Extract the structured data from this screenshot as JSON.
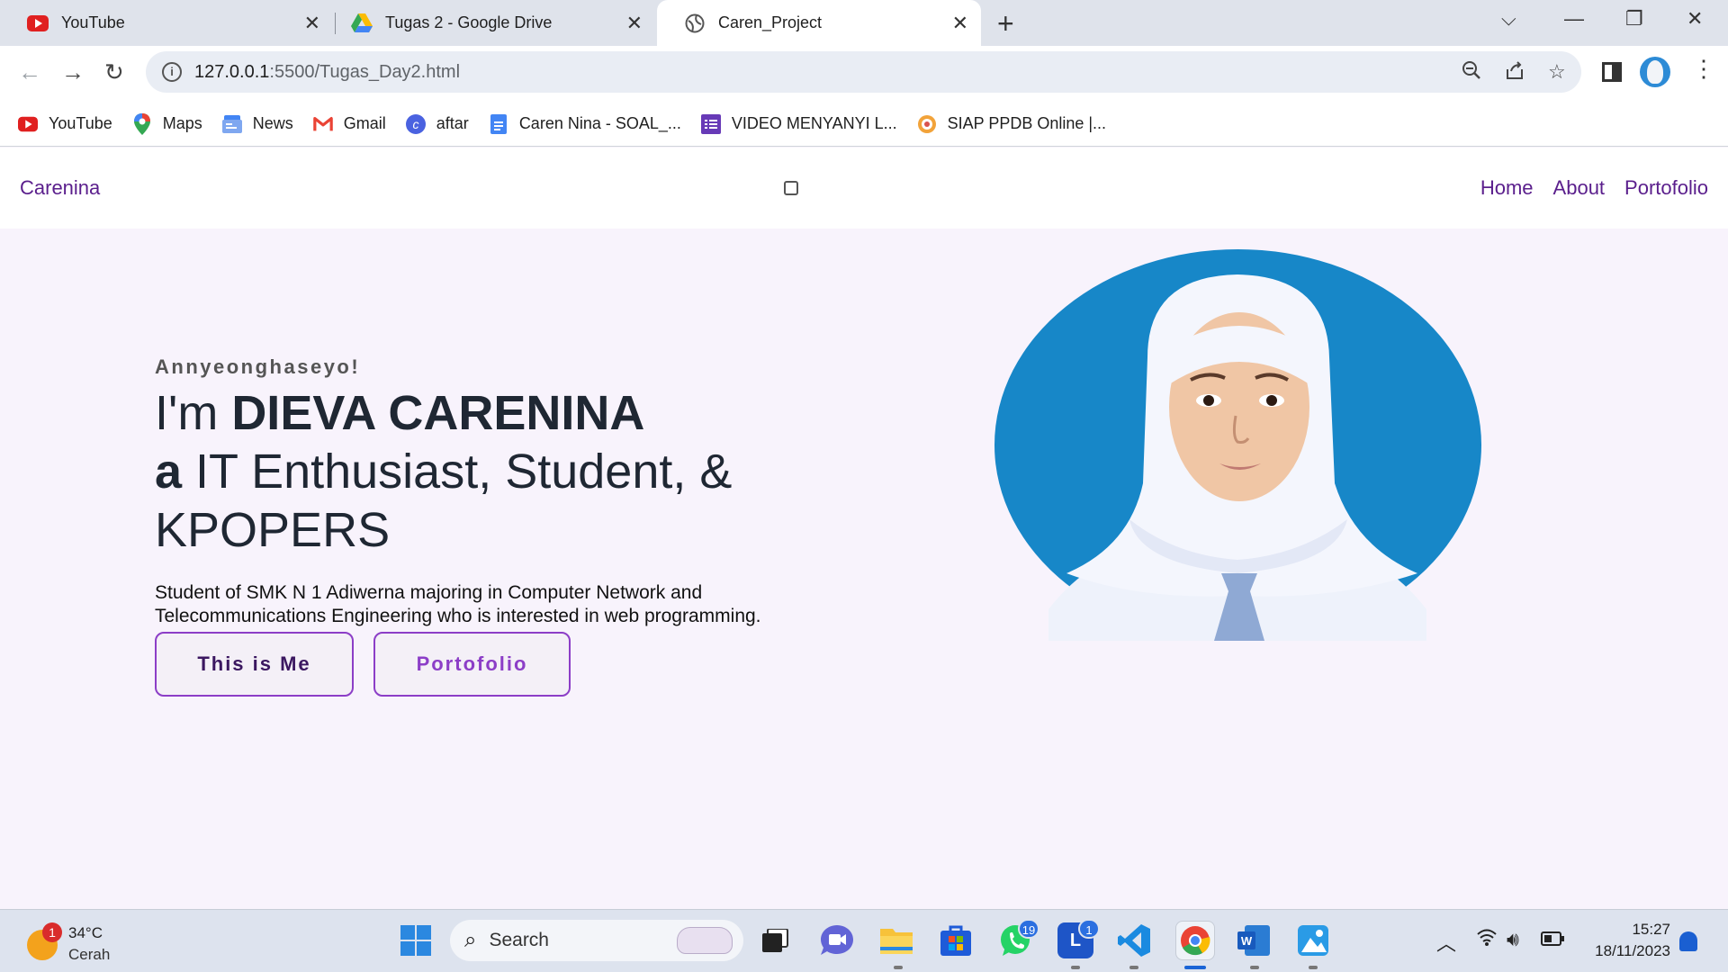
{
  "browser": {
    "tabs": [
      {
        "title": "YouTube",
        "icon": "youtube-icon"
      },
      {
        "title": "Tugas 2 - Google Drive",
        "icon": "google-drive-icon"
      },
      {
        "title": "Caren_Project",
        "icon": "globe-icon",
        "active": true
      }
    ],
    "url_host": "127.0.0.1",
    "url_rest": ":5500/Tugas_Day2.html",
    "bookmarks": [
      {
        "label": "YouTube",
        "icon": "youtube-icon"
      },
      {
        "label": "Maps",
        "icon": "maps-icon"
      },
      {
        "label": "News",
        "icon": "news-icon"
      },
      {
        "label": "Gmail",
        "icon": "gmail-icon"
      },
      {
        "label": "aftar",
        "icon": "canva-icon"
      },
      {
        "label": "Caren Nina - SOAL_...",
        "icon": "docs-icon"
      },
      {
        "label": "VIDEO MENYANYI L...",
        "icon": "forms-icon"
      },
      {
        "label": "SIAP PPDB Online |...",
        "icon": "ppdb-icon"
      }
    ]
  },
  "site": {
    "brand": "Carenina",
    "nav": [
      "Home",
      "About",
      "Portofolio"
    ],
    "greeting": "Annyeonghaseyo!",
    "headline_prefix": "I'm ",
    "name": "DIEVA CARENINA",
    "line2_bold": "a",
    "line2_rest": " IT Enthusiast, Student, &",
    "line3": "KPOPERS",
    "description_1": "Student of SMK N 1 Adiwerna majoring in Computer Network and",
    "description_2": "Telecommunications Engineering who is interested in web programming.",
    "button_primary": "This is Me",
    "button_secondary": "Portofolio"
  },
  "taskbar": {
    "weather_badge": "1",
    "temperature": "34°C",
    "condition": "Cerah",
    "search_label": "Search",
    "whatsapp_badge": "19",
    "line_badge": "1",
    "time": "15:27",
    "date": "18/11/2023"
  },
  "colors": {
    "accent": "#5a1e8c",
    "button_border": "#8c3ec7",
    "page_bg": "#f8f3fc",
    "photo_bg": "#1787c8"
  }
}
